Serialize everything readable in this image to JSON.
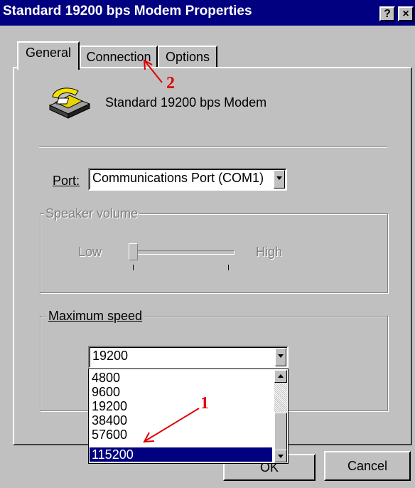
{
  "window": {
    "title": "Standard 19200 bps Modem Properties",
    "help_button": "?",
    "close_button": "×"
  },
  "tabs": [
    {
      "label": "General",
      "active": true
    },
    {
      "label": "Connection",
      "active": false
    },
    {
      "label": "Options",
      "active": false
    }
  ],
  "modem": {
    "name": "Standard 19200 bps Modem",
    "icon": "telephone-modem-icon"
  },
  "port": {
    "label": "Port:",
    "value": "Communications Port (COM1)"
  },
  "speaker_volume": {
    "label": "Speaker volume",
    "low": "Low",
    "high": "High",
    "enabled": false
  },
  "maximum_speed": {
    "label": "Maximum speed",
    "value": "19200",
    "options": [
      "4800",
      "9600",
      "19200",
      "38400",
      "57600",
      "115200"
    ],
    "highlighted": "115200"
  },
  "buttons": {
    "ok": "OK",
    "cancel": "Cancel"
  },
  "annotations": {
    "one": "1",
    "two": "2"
  },
  "colors": {
    "titlebar": "#000080",
    "face": "#c0c0c0",
    "annotation": "#e00000"
  }
}
